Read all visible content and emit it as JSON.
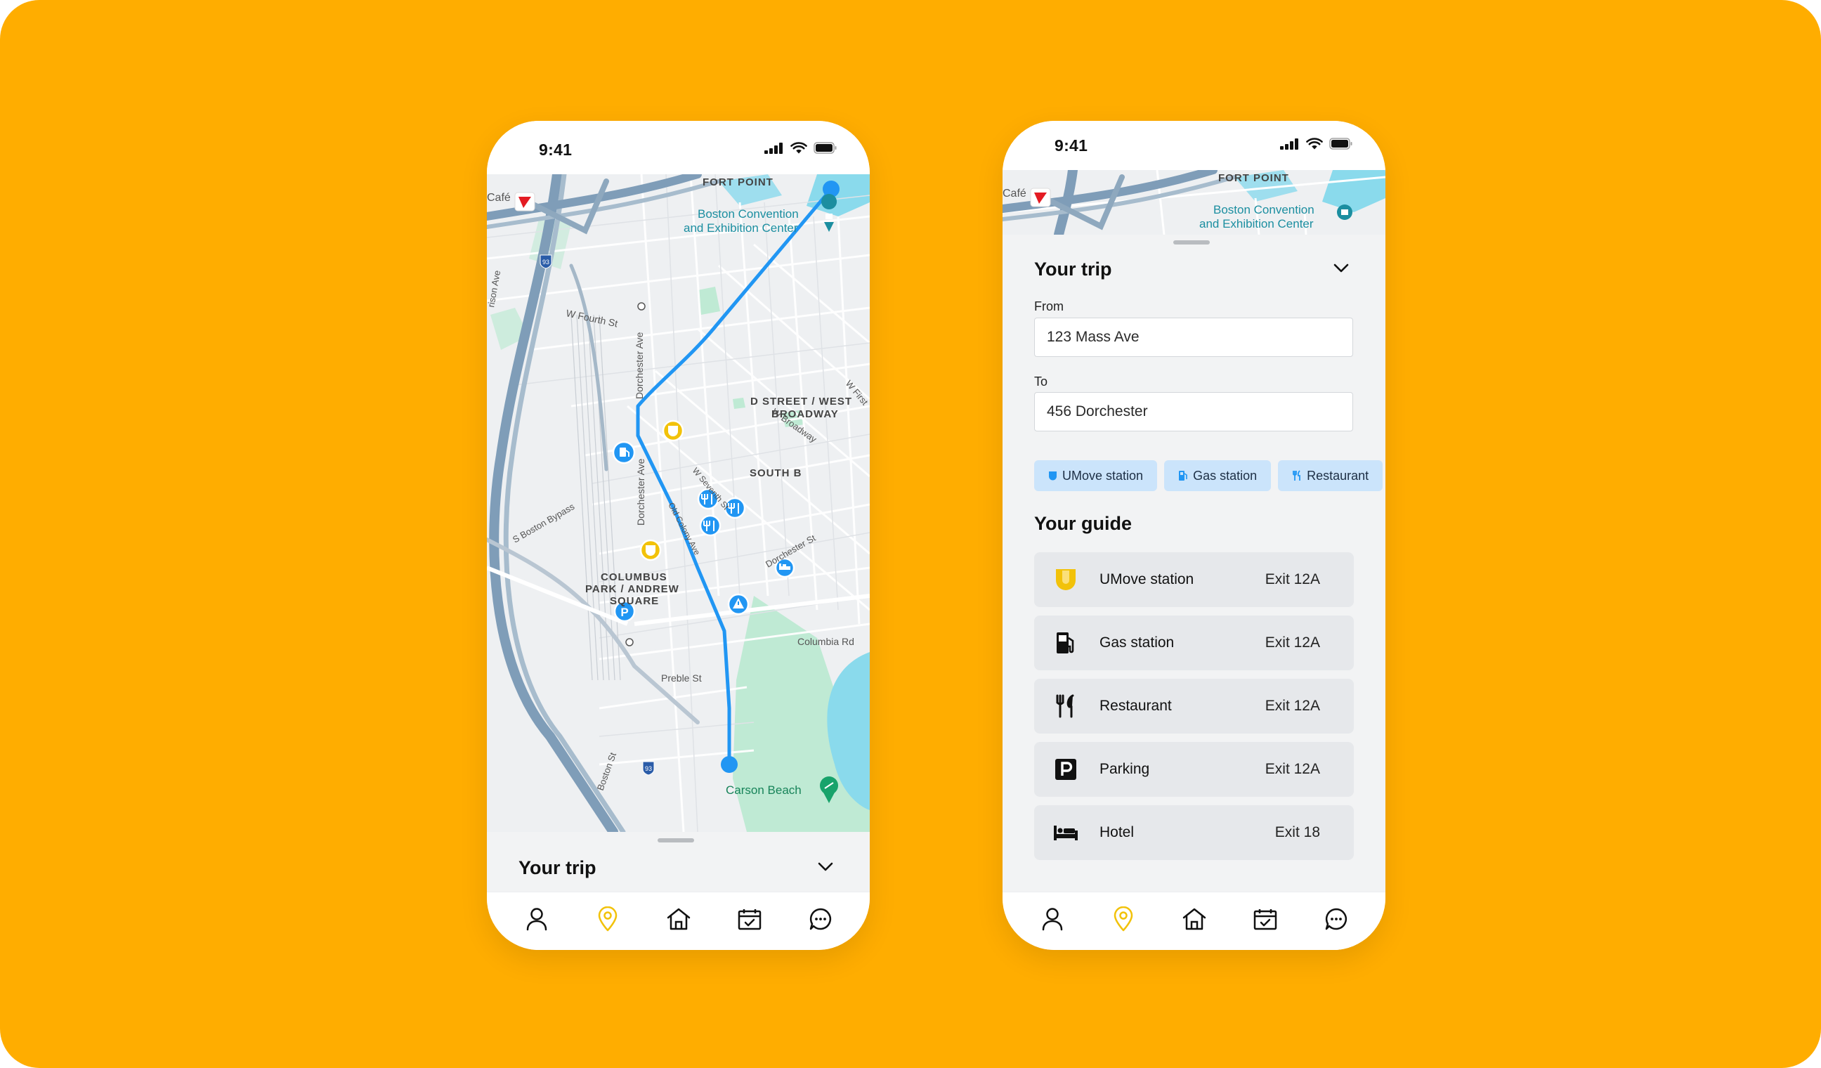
{
  "colors": {
    "background": "#FFAD00",
    "route": "#2196F3",
    "accent_yellow": "#F2C20A",
    "chip_bg": "#CBE4FB",
    "water": "#8ADAEC",
    "park": "#BFEAD4",
    "teal_label": "#1B8EA0"
  },
  "phone_map": {
    "status": {
      "time": "9:41"
    },
    "map": {
      "labels": {
        "fort_point": "FORT POINT",
        "convention": "Boston Convention",
        "convention2": "and Exhibition Center",
        "cafe": "Café",
        "w_fourth": "W Fourth St",
        "dorchester_ave_1": "Dorchester Ave",
        "dorchester_ave_2": "Dorchester Ave",
        "d_street": "D STREET / WEST",
        "broadway": "BROADWAY",
        "w_broadway": "W Broadway",
        "w_first": "W First",
        "s_boston_bypass": "S Boston Bypass",
        "south_b": "SOUTH B",
        "columbus": "COLUMBUS",
        "park_andrew": "PARK / ANDREW",
        "square": "SQUARE",
        "dorchester_st": "Dorchester St",
        "columbia_rd": "Columbia Rd",
        "preble_st": "Preble St",
        "carson_beach": "Carson Beach",
        "boston_st": "Boston St",
        "old_colony": "Old Colony Ave",
        "w_seventh": "W Seventh St",
        "w_side": "rison Ave",
        "shield_93a": "93",
        "shield_93b": "93"
      }
    },
    "sheet": {
      "title": "Your trip"
    }
  },
  "phone_guide": {
    "status": {
      "time": "9:41"
    },
    "map": {
      "labels": {
        "fort_point": "FORT POINT",
        "convention": "Boston Convention",
        "convention2": "and Exhibition Center",
        "cafe": "Café"
      }
    },
    "trip": {
      "title": "Your trip",
      "from_label": "From",
      "from_value": "123 Mass Ave",
      "to_label": "To",
      "to_value": "456 Dorchester"
    },
    "chips": [
      {
        "label": "UMove station",
        "icon": "umove-shield-icon"
      },
      {
        "label": "Gas station",
        "icon": "gas-pump-icon"
      },
      {
        "label": "Restaurant",
        "icon": "fork-knife-icon"
      }
    ],
    "guide": {
      "title": "Your guide",
      "items": [
        {
          "name": "UMove station",
          "exit": "Exit 12A",
          "icon": "umove-shield-icon"
        },
        {
          "name": "Gas station",
          "exit": "Exit 12A",
          "icon": "gas-pump-icon"
        },
        {
          "name": "Restaurant",
          "exit": "Exit 12A",
          "icon": "fork-knife-icon"
        },
        {
          "name": "Parking",
          "exit": "Exit 12A",
          "icon": "parking-icon"
        },
        {
          "name": "Hotel",
          "exit": "Exit 18",
          "icon": "bed-icon"
        }
      ]
    }
  },
  "nav": {
    "items": [
      {
        "icon": "profile-icon",
        "active": false
      },
      {
        "icon": "location-pin-icon",
        "active": true
      },
      {
        "icon": "home-icon",
        "active": false
      },
      {
        "icon": "calendar-icon",
        "active": false
      },
      {
        "icon": "chat-icon",
        "active": false
      }
    ]
  }
}
